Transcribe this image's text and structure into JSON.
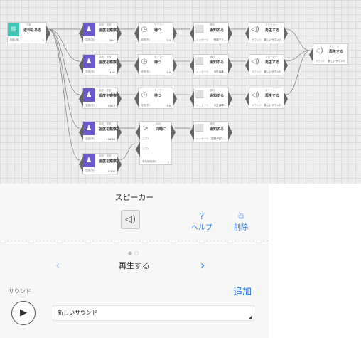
{
  "canvas": {
    "nodes": [
      {
        "id": "start",
        "style": "teal",
        "icon": "≣",
        "small": " 人感",
        "name": "返却もある",
        "param": "起動(増)",
        "value": "1"
      },
      {
        "id": "h1",
        "style": "purple",
        "icon": "♟",
        "small": "温度・湿度",
        "name": "温度を察察...",
        "param": "温度(数)",
        "value": "26·C"
      },
      {
        "id": "h2",
        "style": "purple",
        "icon": "♟",
        "small": "温度・湿度",
        "name": "温度を察察...",
        "param": "温度(数)",
        "value": "74.0F"
      },
      {
        "id": "h3",
        "style": "purple",
        "icon": "♟",
        "small": "温度・湿度",
        "name": "温度を察察...",
        "param": "温度(数)",
        "value": "+28.5"
      },
      {
        "id": "h4",
        "style": "purple",
        "icon": "♟",
        "small": "温度・湿度",
        "name": "温度を察察...",
        "param": "温度(数)",
        "value": "+26.55"
      },
      {
        "id": "h5",
        "style": "purple",
        "icon": "♟",
        "small": "温度・湿度",
        "name": "温度を察察...",
        "param": "温度(数)",
        "value": "0-100"
      },
      {
        "id": "t1",
        "style": "gray",
        "icon": "◷",
        "small": "タイマー",
        "name": "待つ",
        "param": "時間(秒)",
        "value": "3.5"
      },
      {
        "id": "t2",
        "style": "gray",
        "icon": "◷",
        "small": "タイマー",
        "name": "待つ",
        "param": "時間(秒)",
        "value": "3.0"
      },
      {
        "id": "t3",
        "style": "gray",
        "icon": "◷",
        "small": "タイマー",
        "name": "待つ",
        "param": "時間(秒)",
        "value": "3.0"
      },
      {
        "id": "n1",
        "style": "gray",
        "icon": "⬜",
        "small": "通知",
        "name": "通知する",
        "param": "メッセージ",
        "value": "快適です..."
      },
      {
        "id": "n2",
        "style": "gray",
        "icon": "⬜",
        "small": "通知",
        "name": "通知する",
        "param": "メッセージ",
        "value": "今日は暑..."
      },
      {
        "id": "n3",
        "style": "gray",
        "icon": "⬜",
        "small": "通知",
        "name": "通知する",
        "param": "メッセージ",
        "value": "今日は寒..."
      },
      {
        "id": "n4",
        "style": "gray",
        "icon": "⬜",
        "small": "通知",
        "name": "通知する",
        "param": "メッセージ",
        "value": "湿度が高い..."
      },
      {
        "id": "s1",
        "style": "gray",
        "icon": "◁)",
        "small": "スピーカー",
        "name": "再生する",
        "param": "サウンド",
        "value": "新しいサウンド"
      },
      {
        "id": "s2",
        "style": "gray",
        "icon": "◁)",
        "small": "スピーカー",
        "name": "再生する",
        "param": "サウンド",
        "value": "新しいサウンド"
      },
      {
        "id": "s3",
        "style": "gray",
        "icon": "◁)",
        "small": "スピーカー",
        "name": "再生する",
        "param": "サウンド",
        "value": "新しいサウンド"
      },
      {
        "id": "s4",
        "style": "gray",
        "icon": "◁)",
        "small": "スピーカー",
        "name": "再生する",
        "param": "サウンド",
        "value": "新しいサウンド"
      }
    ],
    "logic": {
      "icon": "≻",
      "small": "AND",
      "name": "同時に",
      "in1": "入力1",
      "in2": "入力2",
      "param": "有効時間(秒)",
      "value": "1"
    }
  },
  "panel": {
    "title": "スピーカー",
    "speaker_icon": "◁)",
    "help_icon": "?",
    "help_label": "ヘルプ",
    "delete_icon": "♲",
    "delete_label": "削除",
    "dots": "●○",
    "prev": "‹",
    "next": "›",
    "action": "再生する",
    "sound_label": "サウンド",
    "add_label": "追加",
    "play_icon": "▶",
    "sound_value": "新しいサウンド"
  }
}
